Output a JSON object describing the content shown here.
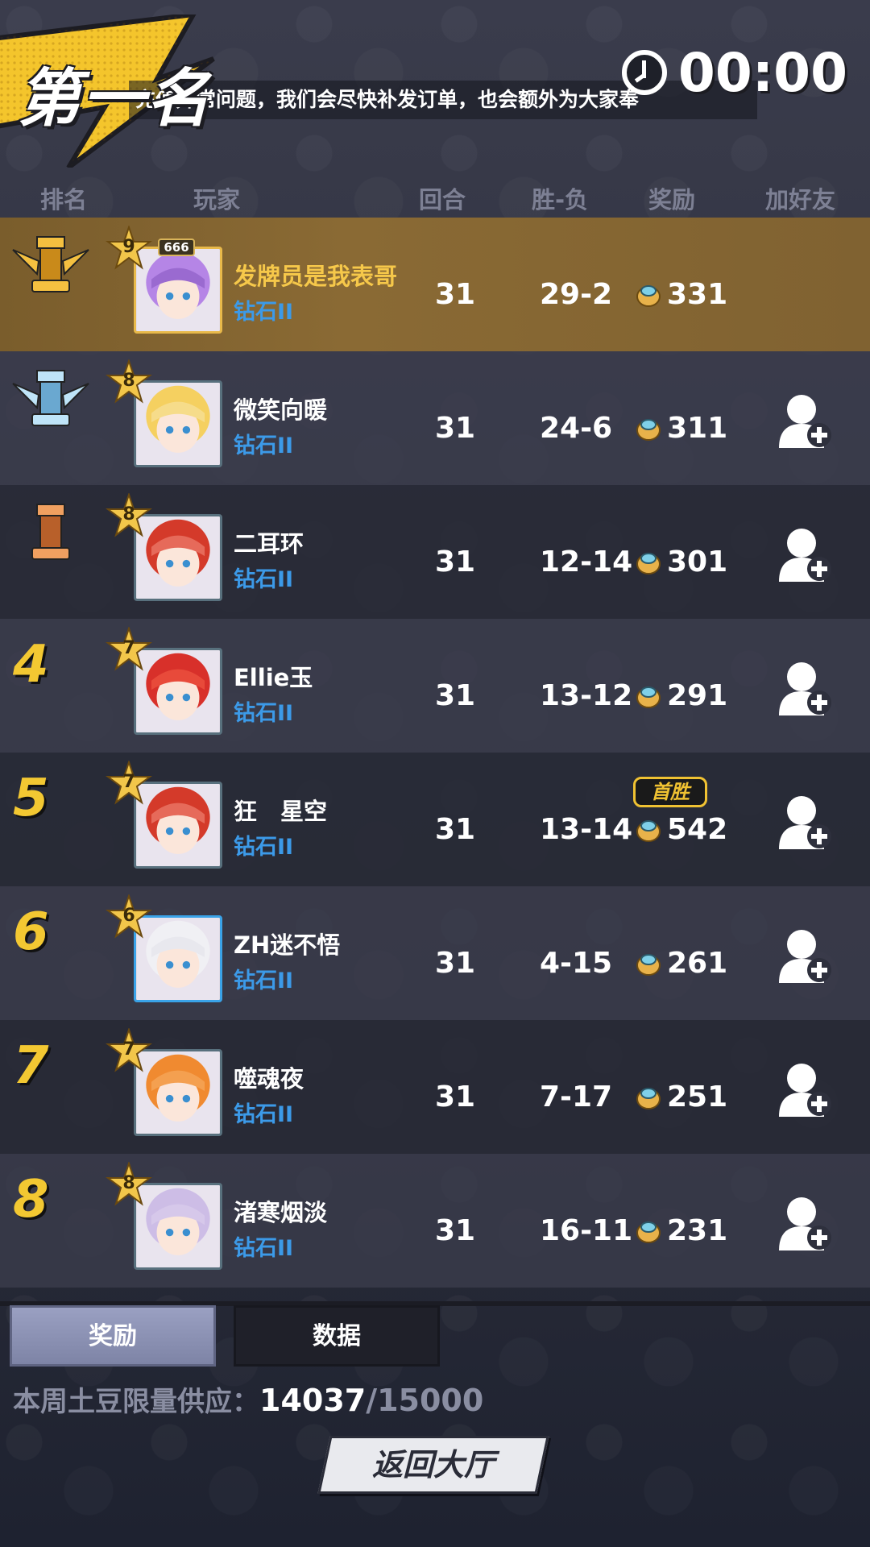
{
  "header": {
    "rank_title": "第一名",
    "ticker_text": "充值异常问题，我们会尽快补发订单，也会额外为大家奉",
    "timer": "00:00"
  },
  "columns": {
    "rank": "排名",
    "player": "玩家",
    "rounds": "回合",
    "winloss": "胜-负",
    "reward": "奖励",
    "add_friend": "加好友"
  },
  "rows": [
    {
      "rank": "1",
      "rank_type": "gold",
      "level": "9",
      "vip": "666",
      "name": "发牌员是我表哥",
      "tier": "钻石II",
      "rounds": "31",
      "winloss": "29-2",
      "reward": "331",
      "first_win": "",
      "avatar_color": "#9a6ad0",
      "hair": "#b585e6"
    },
    {
      "rank": "2",
      "rank_type": "silver",
      "level": "8",
      "vip": "",
      "name": "微笑向暖",
      "tier": "钻石II",
      "rounds": "31",
      "winloss": "24-6",
      "reward": "311",
      "first_win": "",
      "avatar_color": "#f6dc8a",
      "hair": "#f5d060"
    },
    {
      "rank": "3",
      "rank_type": "bronze",
      "level": "8",
      "vip": "",
      "name": "二耳环",
      "tier": "钻石II",
      "rounds": "31",
      "winloss": "12-14",
      "reward": "301",
      "first_win": "",
      "avatar_color": "#e66a5a",
      "hair": "#d43a2a"
    },
    {
      "rank": "4",
      "rank_type": "num",
      "level": "7",
      "vip": "",
      "name": "Ellie玉",
      "tier": "钻石II",
      "rounds": "31",
      "winloss": "13-12",
      "reward": "291",
      "first_win": "",
      "avatar_color": "#e84a3a",
      "hair": "#d8302a"
    },
    {
      "rank": "5",
      "rank_type": "num",
      "level": "7",
      "vip": "",
      "name": "狂　星空",
      "tier": "钻石II",
      "rounds": "31",
      "winloss": "13-14",
      "reward": "542",
      "first_win": "首胜",
      "avatar_color": "#e66a5a",
      "hair": "#d43a2a"
    },
    {
      "rank": "6",
      "rank_type": "num",
      "level": "6",
      "vip": "",
      "name": "ZH迷不悟",
      "tier": "钻石II",
      "rounds": "31",
      "winloss": "4-15",
      "reward": "261",
      "first_win": "",
      "avatar_color": "#e8e8ee",
      "hair": "#f0f0f4"
    },
    {
      "rank": "7",
      "rank_type": "num",
      "level": "7",
      "vip": "",
      "name": "噬魂夜",
      "tier": "钻石II",
      "rounds": "31",
      "winloss": "7-17",
      "reward": "251",
      "first_win": "",
      "avatar_color": "#f4a050",
      "hair": "#f08a30"
    },
    {
      "rank": "8",
      "rank_type": "num",
      "level": "8",
      "vip": "",
      "name": "渚寒烟淡",
      "tier": "钻石II",
      "rounds": "31",
      "winloss": "16-11",
      "reward": "231",
      "first_win": "",
      "avatar_color": "#d6c8ea",
      "hair": "#cdbde6"
    }
  ],
  "tabs": {
    "reward": "奖励",
    "data": "数据"
  },
  "supply": {
    "label": "本周土豆限量供应：",
    "current": "14037",
    "max": "/15000"
  },
  "return_button": "返回大厅",
  "colors": {
    "gold_row": "#806231",
    "tier_blue": "#3c9ae8",
    "rank_yellow": "#f3c832"
  }
}
